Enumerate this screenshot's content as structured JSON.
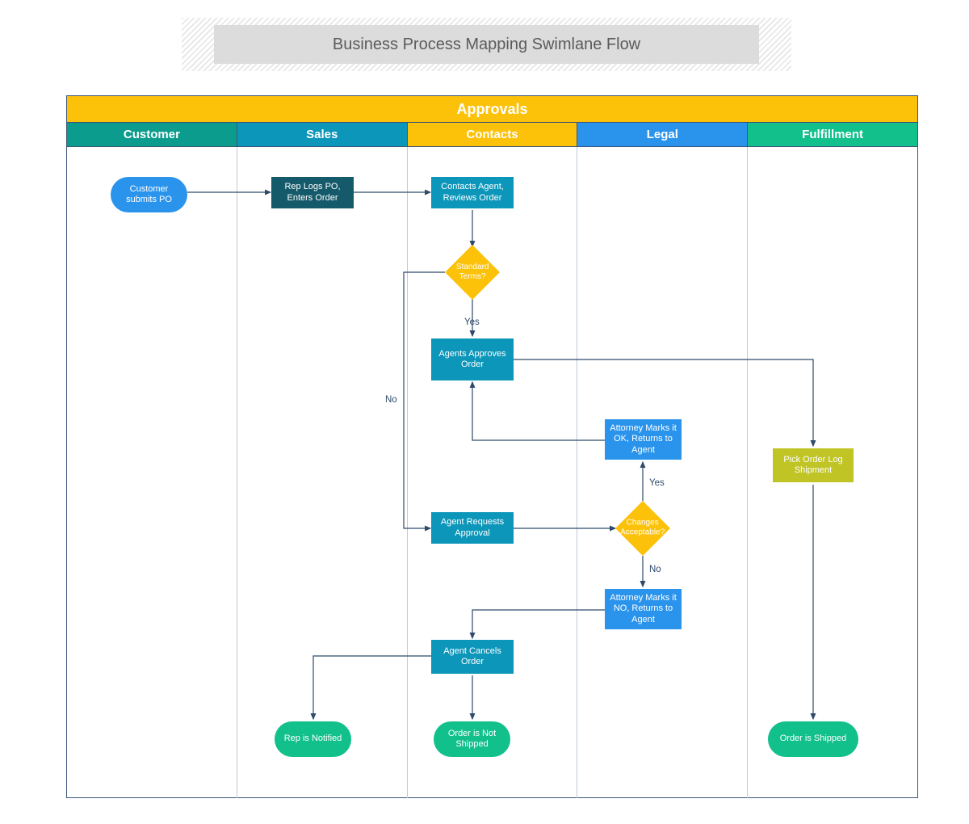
{
  "title": "Business Process Mapping Swimlane Flow",
  "pool_title": "Approvals",
  "lanes": [
    "Customer",
    "Sales",
    "Contacts",
    "Legal",
    "Fulfillment"
  ],
  "lane_colors": [
    "#0c9c8d",
    "#0c96ba",
    "#fcc109",
    "#2a94ec",
    "#12c08b"
  ],
  "nodes": {
    "customer_po": "Customer submits PO",
    "rep_logs": "Rep Logs PO, Enters Order",
    "contacts_agent": "Contacts Agent, Reviews Order",
    "standard_terms": "Standard Terms?",
    "agents_approves": "Agents Approves Order",
    "agent_requests": "Agent Requests Approval",
    "agent_cancels": "Agent Cancels Order",
    "attorney_ok": "Attorney Marks it OK, Returns to Agent",
    "changes_acceptable": "Changes Acceptable?",
    "attorney_no": "Attorney Marks it NO, Returns to Agent",
    "pick_order": "Pick Order Log Shipment",
    "rep_notified": "Rep is Notified",
    "order_not_shipped": "Order is Not Shipped",
    "order_shipped": "Order is Shipped"
  },
  "labels": {
    "yes": "Yes",
    "no": "No"
  },
  "colors": {
    "bright_blue": "#2a94ec",
    "teal_process": "#0c96ba",
    "dark_teal": "#155a6b",
    "gold": "#fcc109",
    "green": "#12c08b",
    "olive": "#c0c425",
    "line": "#2f4a6b"
  }
}
